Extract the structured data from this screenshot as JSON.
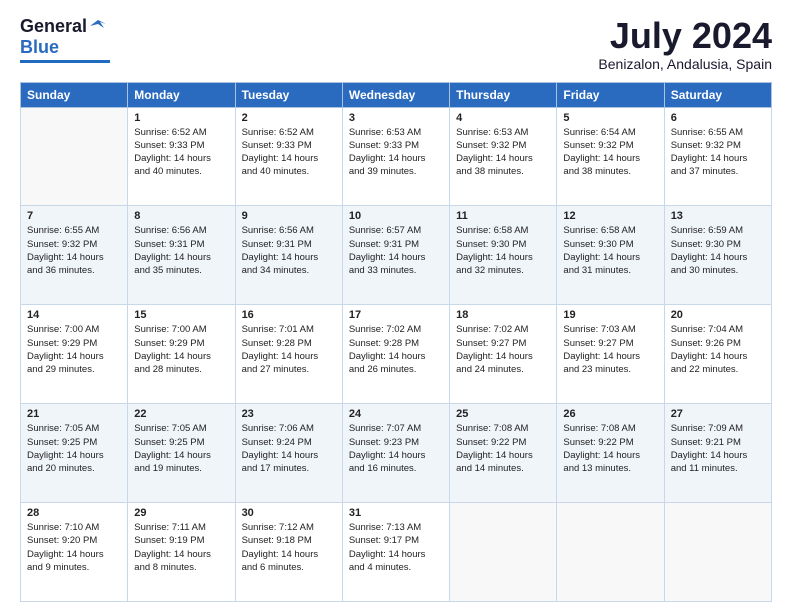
{
  "logo": {
    "text_general": "General",
    "text_blue": "Blue"
  },
  "title": "July 2024",
  "location": "Benizalon, Andalusia, Spain",
  "days_header": [
    "Sunday",
    "Monday",
    "Tuesday",
    "Wednesday",
    "Thursday",
    "Friday",
    "Saturday"
  ],
  "weeks": [
    [
      {
        "day": "",
        "sunrise": "",
        "sunset": "",
        "daylight": ""
      },
      {
        "day": "1",
        "sunrise": "Sunrise: 6:52 AM",
        "sunset": "Sunset: 9:33 PM",
        "daylight": "Daylight: 14 hours and 40 minutes."
      },
      {
        "day": "2",
        "sunrise": "Sunrise: 6:52 AM",
        "sunset": "Sunset: 9:33 PM",
        "daylight": "Daylight: 14 hours and 40 minutes."
      },
      {
        "day": "3",
        "sunrise": "Sunrise: 6:53 AM",
        "sunset": "Sunset: 9:33 PM",
        "daylight": "Daylight: 14 hours and 39 minutes."
      },
      {
        "day": "4",
        "sunrise": "Sunrise: 6:53 AM",
        "sunset": "Sunset: 9:32 PM",
        "daylight": "Daylight: 14 hours and 38 minutes."
      },
      {
        "day": "5",
        "sunrise": "Sunrise: 6:54 AM",
        "sunset": "Sunset: 9:32 PM",
        "daylight": "Daylight: 14 hours and 38 minutes."
      },
      {
        "day": "6",
        "sunrise": "Sunrise: 6:55 AM",
        "sunset": "Sunset: 9:32 PM",
        "daylight": "Daylight: 14 hours and 37 minutes."
      }
    ],
    [
      {
        "day": "7",
        "sunrise": "Sunrise: 6:55 AM",
        "sunset": "Sunset: 9:32 PM",
        "daylight": "Daylight: 14 hours and 36 minutes."
      },
      {
        "day": "8",
        "sunrise": "Sunrise: 6:56 AM",
        "sunset": "Sunset: 9:31 PM",
        "daylight": "Daylight: 14 hours and 35 minutes."
      },
      {
        "day": "9",
        "sunrise": "Sunrise: 6:56 AM",
        "sunset": "Sunset: 9:31 PM",
        "daylight": "Daylight: 14 hours and 34 minutes."
      },
      {
        "day": "10",
        "sunrise": "Sunrise: 6:57 AM",
        "sunset": "Sunset: 9:31 PM",
        "daylight": "Daylight: 14 hours and 33 minutes."
      },
      {
        "day": "11",
        "sunrise": "Sunrise: 6:58 AM",
        "sunset": "Sunset: 9:30 PM",
        "daylight": "Daylight: 14 hours and 32 minutes."
      },
      {
        "day": "12",
        "sunrise": "Sunrise: 6:58 AM",
        "sunset": "Sunset: 9:30 PM",
        "daylight": "Daylight: 14 hours and 31 minutes."
      },
      {
        "day": "13",
        "sunrise": "Sunrise: 6:59 AM",
        "sunset": "Sunset: 9:30 PM",
        "daylight": "Daylight: 14 hours and 30 minutes."
      }
    ],
    [
      {
        "day": "14",
        "sunrise": "Sunrise: 7:00 AM",
        "sunset": "Sunset: 9:29 PM",
        "daylight": "Daylight: 14 hours and 29 minutes."
      },
      {
        "day": "15",
        "sunrise": "Sunrise: 7:00 AM",
        "sunset": "Sunset: 9:29 PM",
        "daylight": "Daylight: 14 hours and 28 minutes."
      },
      {
        "day": "16",
        "sunrise": "Sunrise: 7:01 AM",
        "sunset": "Sunset: 9:28 PM",
        "daylight": "Daylight: 14 hours and 27 minutes."
      },
      {
        "day": "17",
        "sunrise": "Sunrise: 7:02 AM",
        "sunset": "Sunset: 9:28 PM",
        "daylight": "Daylight: 14 hours and 26 minutes."
      },
      {
        "day": "18",
        "sunrise": "Sunrise: 7:02 AM",
        "sunset": "Sunset: 9:27 PM",
        "daylight": "Daylight: 14 hours and 24 minutes."
      },
      {
        "day": "19",
        "sunrise": "Sunrise: 7:03 AM",
        "sunset": "Sunset: 9:27 PM",
        "daylight": "Daylight: 14 hours and 23 minutes."
      },
      {
        "day": "20",
        "sunrise": "Sunrise: 7:04 AM",
        "sunset": "Sunset: 9:26 PM",
        "daylight": "Daylight: 14 hours and 22 minutes."
      }
    ],
    [
      {
        "day": "21",
        "sunrise": "Sunrise: 7:05 AM",
        "sunset": "Sunset: 9:25 PM",
        "daylight": "Daylight: 14 hours and 20 minutes."
      },
      {
        "day": "22",
        "sunrise": "Sunrise: 7:05 AM",
        "sunset": "Sunset: 9:25 PM",
        "daylight": "Daylight: 14 hours and 19 minutes."
      },
      {
        "day": "23",
        "sunrise": "Sunrise: 7:06 AM",
        "sunset": "Sunset: 9:24 PM",
        "daylight": "Daylight: 14 hours and 17 minutes."
      },
      {
        "day": "24",
        "sunrise": "Sunrise: 7:07 AM",
        "sunset": "Sunset: 9:23 PM",
        "daylight": "Daylight: 14 hours and 16 minutes."
      },
      {
        "day": "25",
        "sunrise": "Sunrise: 7:08 AM",
        "sunset": "Sunset: 9:22 PM",
        "daylight": "Daylight: 14 hours and 14 minutes."
      },
      {
        "day": "26",
        "sunrise": "Sunrise: 7:08 AM",
        "sunset": "Sunset: 9:22 PM",
        "daylight": "Daylight: 14 hours and 13 minutes."
      },
      {
        "day": "27",
        "sunrise": "Sunrise: 7:09 AM",
        "sunset": "Sunset: 9:21 PM",
        "daylight": "Daylight: 14 hours and 11 minutes."
      }
    ],
    [
      {
        "day": "28",
        "sunrise": "Sunrise: 7:10 AM",
        "sunset": "Sunset: 9:20 PM",
        "daylight": "Daylight: 14 hours and 9 minutes."
      },
      {
        "day": "29",
        "sunrise": "Sunrise: 7:11 AM",
        "sunset": "Sunset: 9:19 PM",
        "daylight": "Daylight: 14 hours and 8 minutes."
      },
      {
        "day": "30",
        "sunrise": "Sunrise: 7:12 AM",
        "sunset": "Sunset: 9:18 PM",
        "daylight": "Daylight: 14 hours and 6 minutes."
      },
      {
        "day": "31",
        "sunrise": "Sunrise: 7:13 AM",
        "sunset": "Sunset: 9:17 PM",
        "daylight": "Daylight: 14 hours and 4 minutes."
      },
      {
        "day": "",
        "sunrise": "",
        "sunset": "",
        "daylight": ""
      },
      {
        "day": "",
        "sunrise": "",
        "sunset": "",
        "daylight": ""
      },
      {
        "day": "",
        "sunrise": "",
        "sunset": "",
        "daylight": ""
      }
    ]
  ]
}
